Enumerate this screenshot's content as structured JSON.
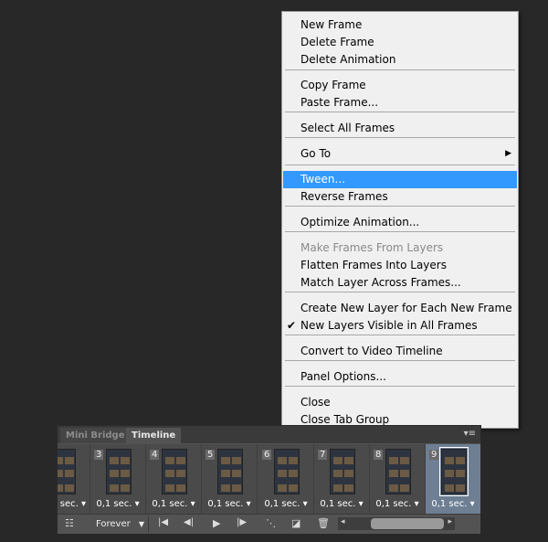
{
  "menu": {
    "items": [
      {
        "label": "New Frame",
        "enabled": true
      },
      {
        "label": "Delete Frame",
        "enabled": true
      },
      {
        "label": "Delete Animation",
        "enabled": true
      },
      {
        "label": "Copy Frame",
        "enabled": true
      },
      {
        "label": "Paste Frame...",
        "enabled": true
      },
      {
        "label": "Select All Frames",
        "enabled": true
      },
      {
        "label": "Go To",
        "enabled": true,
        "submenu": true
      },
      {
        "label": "Tween...",
        "enabled": true,
        "highlighted": true
      },
      {
        "label": "Reverse Frames",
        "enabled": true
      },
      {
        "label": "Optimize Animation...",
        "enabled": true
      },
      {
        "label": "Make Frames From Layers",
        "enabled": false
      },
      {
        "label": "Flatten Frames Into Layers",
        "enabled": true
      },
      {
        "label": "Match Layer Across Frames...",
        "enabled": true
      },
      {
        "label": "Create New Layer for Each New Frame",
        "enabled": true
      },
      {
        "label": "New Layers Visible in All Frames",
        "enabled": true,
        "checked": true
      },
      {
        "label": "Convert to Video Timeline",
        "enabled": true
      },
      {
        "label": "Panel Options...",
        "enabled": true
      },
      {
        "label": "Close",
        "enabled": true
      },
      {
        "label": "Close Tab Group",
        "enabled": true
      }
    ],
    "highlight_color": "#3399ff",
    "check_glyph": "✔",
    "submenu_glyph": "▶"
  },
  "panel": {
    "tabs": [
      "Mini Bridge",
      "Timeline"
    ],
    "active_tab": "Timeline",
    "frames": [
      {
        "num": "",
        "time": "sec. ▾"
      },
      {
        "num": "3",
        "time": "0,1 sec. ▾"
      },
      {
        "num": "4",
        "time": "0,1 sec. ▾"
      },
      {
        "num": "5",
        "time": "0,1 sec. ▾"
      },
      {
        "num": "6",
        "time": "0,1 sec. ▾"
      },
      {
        "num": "7",
        "time": "0,1 sec. ▾"
      },
      {
        "num": "8",
        "time": "0,1 sec. ▾"
      },
      {
        "num": "9",
        "time": "0,1 sec. ▾",
        "selected": true
      }
    ],
    "loop": "Forever",
    "loop_arrow": "▼",
    "icons": {
      "options": "☷",
      "first": "|◀",
      "prev": "◀|",
      "play": "▶",
      "next": "|▶",
      "tween": "⋱",
      "new_frame": "◪",
      "delete": "🗑",
      "scroll_left": "◂",
      "scroll_right": "▸",
      "panel_menu": "▾≡"
    }
  }
}
